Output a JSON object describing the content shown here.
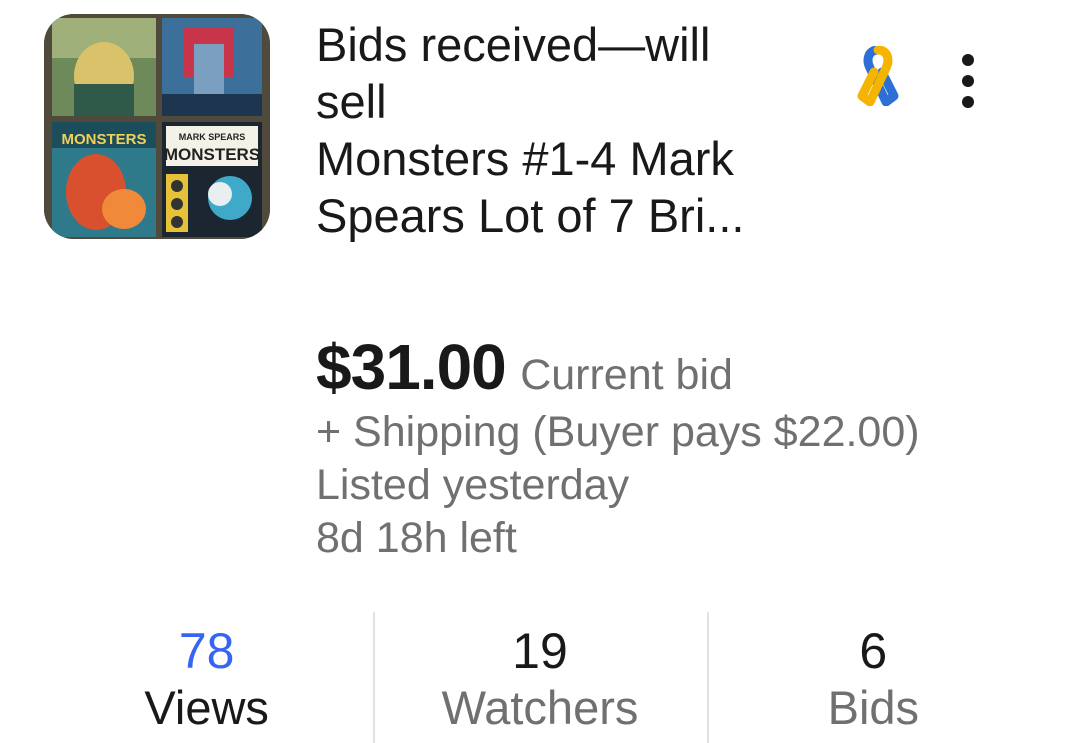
{
  "listing": {
    "title_line1": "Bids received—will",
    "title_line2": "sell",
    "title_line3": "Monsters #1-4 Mark",
    "title_line4": "Spears Lot of 7 Bri...",
    "price": "$31.00",
    "price_label": "Current bid",
    "shipping": "+ Shipping (Buyer pays $22.00)",
    "listed": "Listed yesterday",
    "time_left": "8d 18h left"
  },
  "stats": [
    {
      "value": "78",
      "label": "Views"
    },
    {
      "value": "19",
      "label": "Watchers"
    },
    {
      "value": "6",
      "label": "Bids"
    }
  ],
  "thumbnail": {
    "cover_text_1": "MONSTERS",
    "cover_text_2": "MARK SPEARS",
    "cover_text_3": "MONSTERS"
  },
  "icons": {
    "ribbon": "awareness-ribbon-icon",
    "menu": "more-vertical-icon"
  },
  "colors": {
    "accent": "#3665f3",
    "primary_text": "#191919",
    "secondary_text": "#707070",
    "ribbon_blue": "#2e6fd6",
    "ribbon_yellow": "#f5b400"
  }
}
